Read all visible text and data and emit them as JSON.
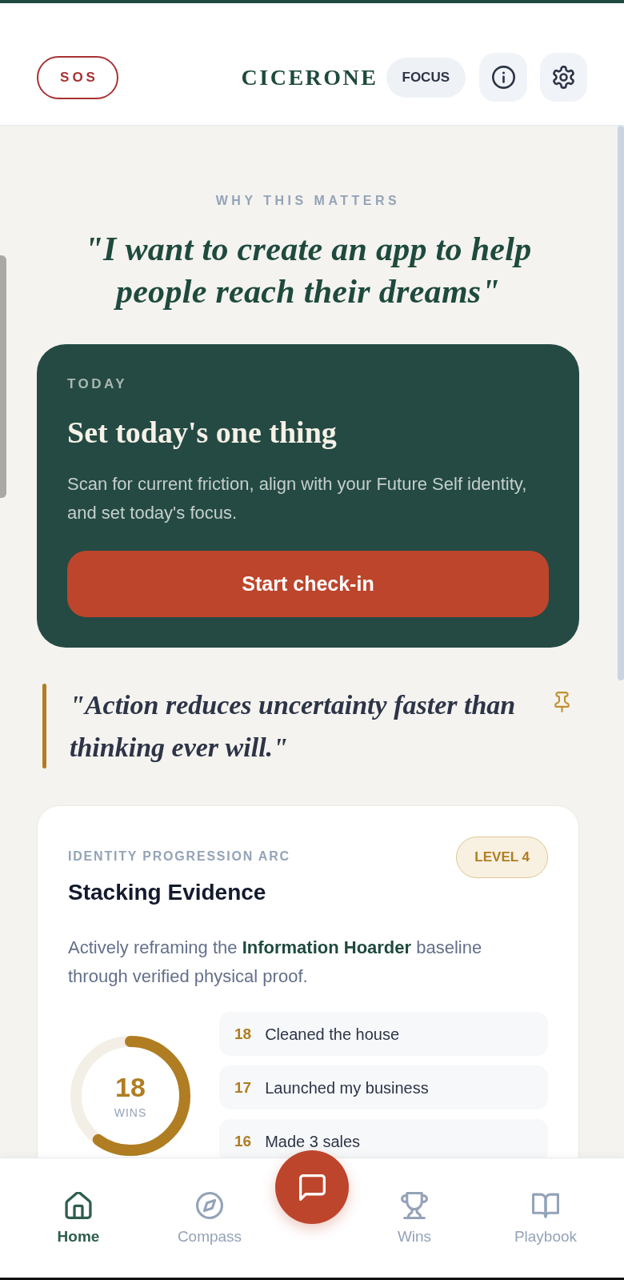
{
  "header": {
    "sos_label": "SOS",
    "brand": "CICERONE",
    "focus_label": "FOCUS"
  },
  "purpose": {
    "eyebrow": "WHY THIS MATTERS",
    "quote": "\"I want to create an app to help people reach their dreams\""
  },
  "today_card": {
    "eyebrow": "TODAY",
    "title": "Set today's one thing",
    "description": "Scan for current friction, align with your Future Self identity, and set today's focus.",
    "button": "Start check-in"
  },
  "pinned_quote": {
    "text": "\"Action reduces uncertainty faster than thinking ever will.\"",
    "pinned": true
  },
  "identity_card": {
    "eyebrow": "IDENTITY PROGRESSION ARC",
    "badge": "LEVEL 4",
    "title": "Stacking Evidence",
    "description": "Actively reframing the **Information Hoarder** baseline through verified physical proof.",
    "wins_meter": {
      "value": "18",
      "unit": "WINS",
      "level": 0.6
    },
    "wins": [
      {
        "number": "18",
        "label": "Cleaned the house"
      },
      {
        "number": "17",
        "label": "Launched my business"
      },
      {
        "number": "16",
        "label": "Made 3 sales"
      }
    ]
  },
  "bottom_nav": {
    "items": [
      {
        "label": "Home",
        "selected": true
      },
      {
        "label": "Compass",
        "selected": false
      },
      {
        "label": "Wins",
        "selected": false
      },
      {
        "label": "Playbook",
        "selected": false
      }
    ]
  }
}
